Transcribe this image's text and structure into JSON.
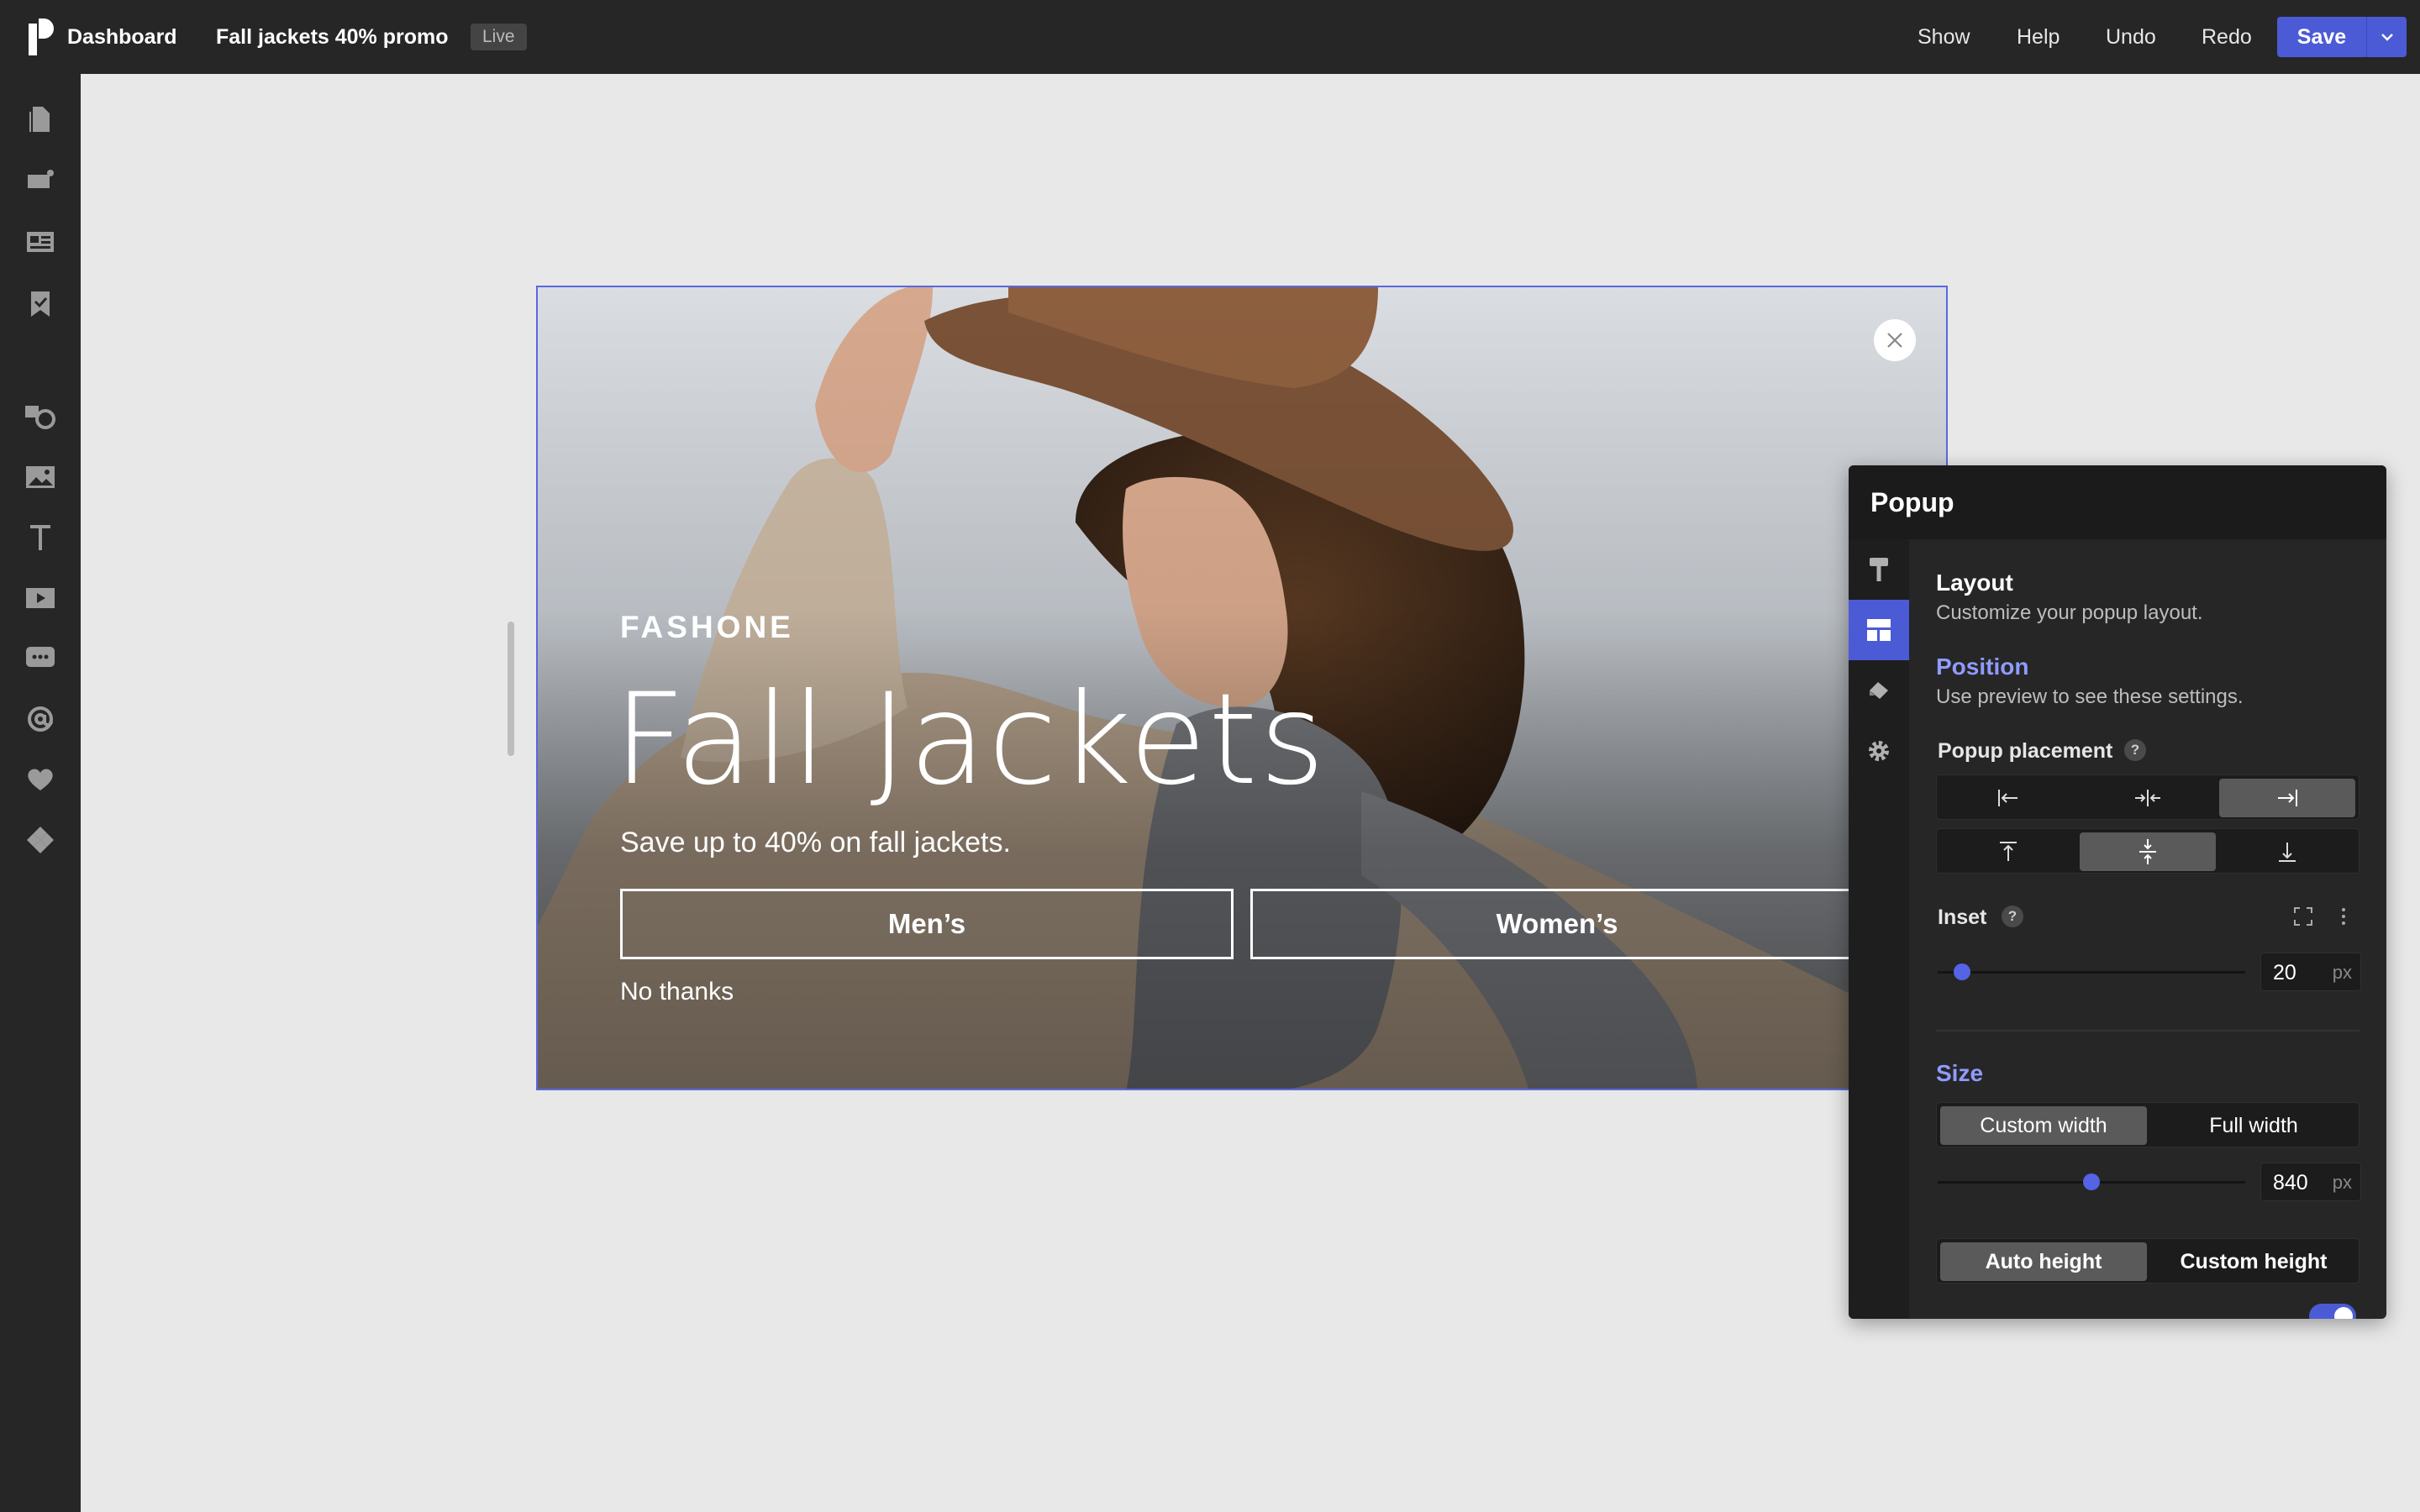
{
  "topbar": {
    "dashboard": "Dashboard",
    "title": "Fall jackets 40% promo",
    "status": "Live",
    "show": "Show",
    "help": "Help",
    "undo": "Undo",
    "redo": "Redo",
    "save": "Save"
  },
  "lefttools": [
    {
      "icon": "pages-icon"
    },
    {
      "icon": "popup-icon"
    },
    {
      "icon": "layout-icon"
    },
    {
      "icon": "bookmark-icon"
    },
    {
      "icon": "shapes-icon"
    },
    {
      "icon": "image-icon"
    },
    {
      "icon": "text-icon"
    },
    {
      "icon": "video-icon"
    },
    {
      "icon": "chat-icon"
    },
    {
      "icon": "email-icon"
    },
    {
      "icon": "heart-icon"
    },
    {
      "icon": "integrations-icon"
    }
  ],
  "popup": {
    "brand": "FASHONE",
    "headline": "Fall Jackets",
    "subline": "Save up to 40% on fall jackets.",
    "cta_men": "Men’s",
    "cta_women": "Women’s",
    "no_thanks": "No thanks"
  },
  "panel": {
    "title": "Popup",
    "layout_title": "Layout",
    "layout_sub": "Customize your popup layout.",
    "position_title": "Position",
    "position_sub": "Use preview to see these settings.",
    "placement_label": "Popup placement",
    "inset_label": "Inset",
    "inset_value": "20",
    "inset_unit": "px",
    "inset_slider_fraction": 0.08,
    "size_title": "Size",
    "custom_width": "Custom width",
    "full_width": "Full width",
    "width_value": "840",
    "width_unit": "px",
    "width_slider_fraction": 0.5,
    "auto_height": "Auto height",
    "custom_height": "Custom height",
    "question_mark": "?"
  },
  "colors": {
    "accent": "#4b5bd6",
    "accent_text": "#8f9bff",
    "topbar": "#262626",
    "canvas": "#e8e8e8"
  }
}
